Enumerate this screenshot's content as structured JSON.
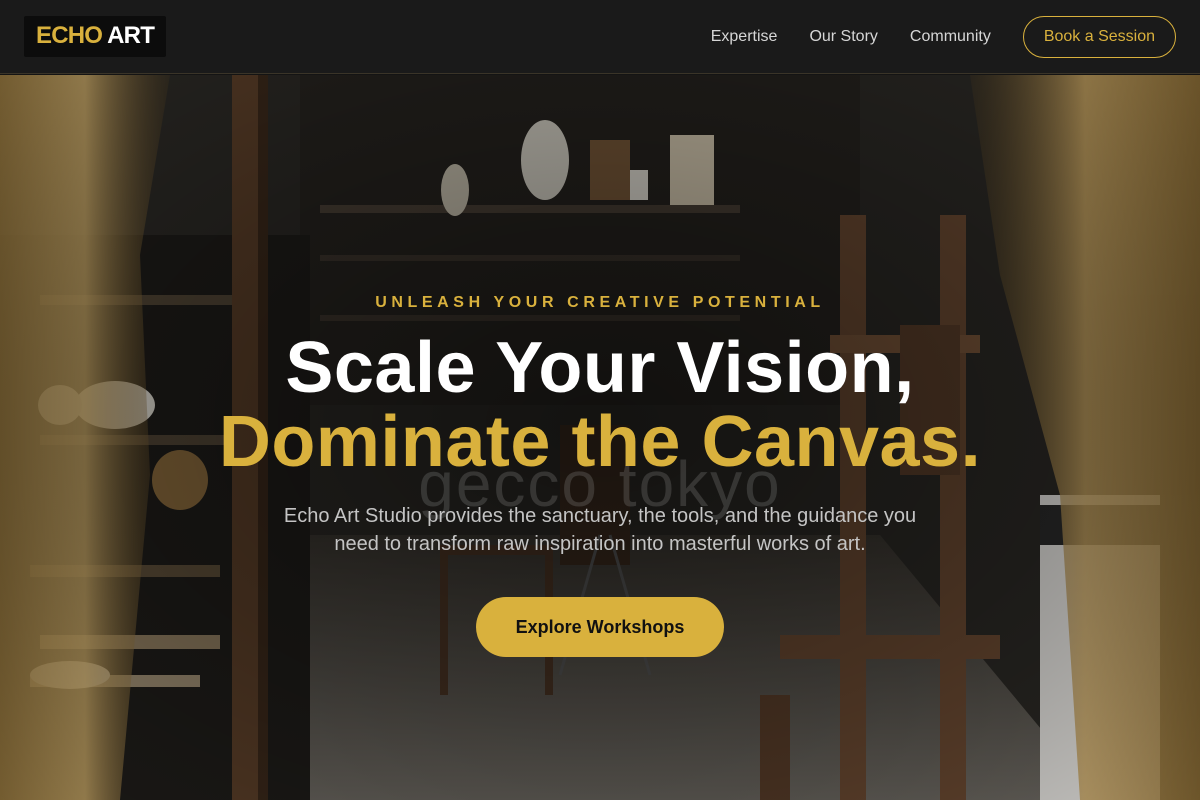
{
  "brand": {
    "logo_part1": "ECHO",
    "logo_part2": "ART"
  },
  "nav": {
    "links": [
      {
        "label": "Expertise"
      },
      {
        "label": "Our Story"
      },
      {
        "label": "Community"
      }
    ],
    "cta_label": "Book a Session"
  },
  "hero": {
    "eyebrow": "UNLEASH YOUR CREATIVE POTENTIAL",
    "headline_line1": "Scale Your Vision,",
    "headline_line2": "Dominate the Canvas.",
    "watermark": "gecco tokyo",
    "subtext": "Echo Art Studio provides the sanctuary, the tools, and the guidance you need to transform raw inspiration into masterful works of art.",
    "cta_label": "Explore Workshops",
    "background_image": "art-studio-photo"
  },
  "colors": {
    "accent": "#d9b13d",
    "navbar_bg": "#1a1a1a",
    "logo_bg": "#0c0c0c",
    "text_white": "#ffffff",
    "subtext": "#c4c4c4"
  }
}
